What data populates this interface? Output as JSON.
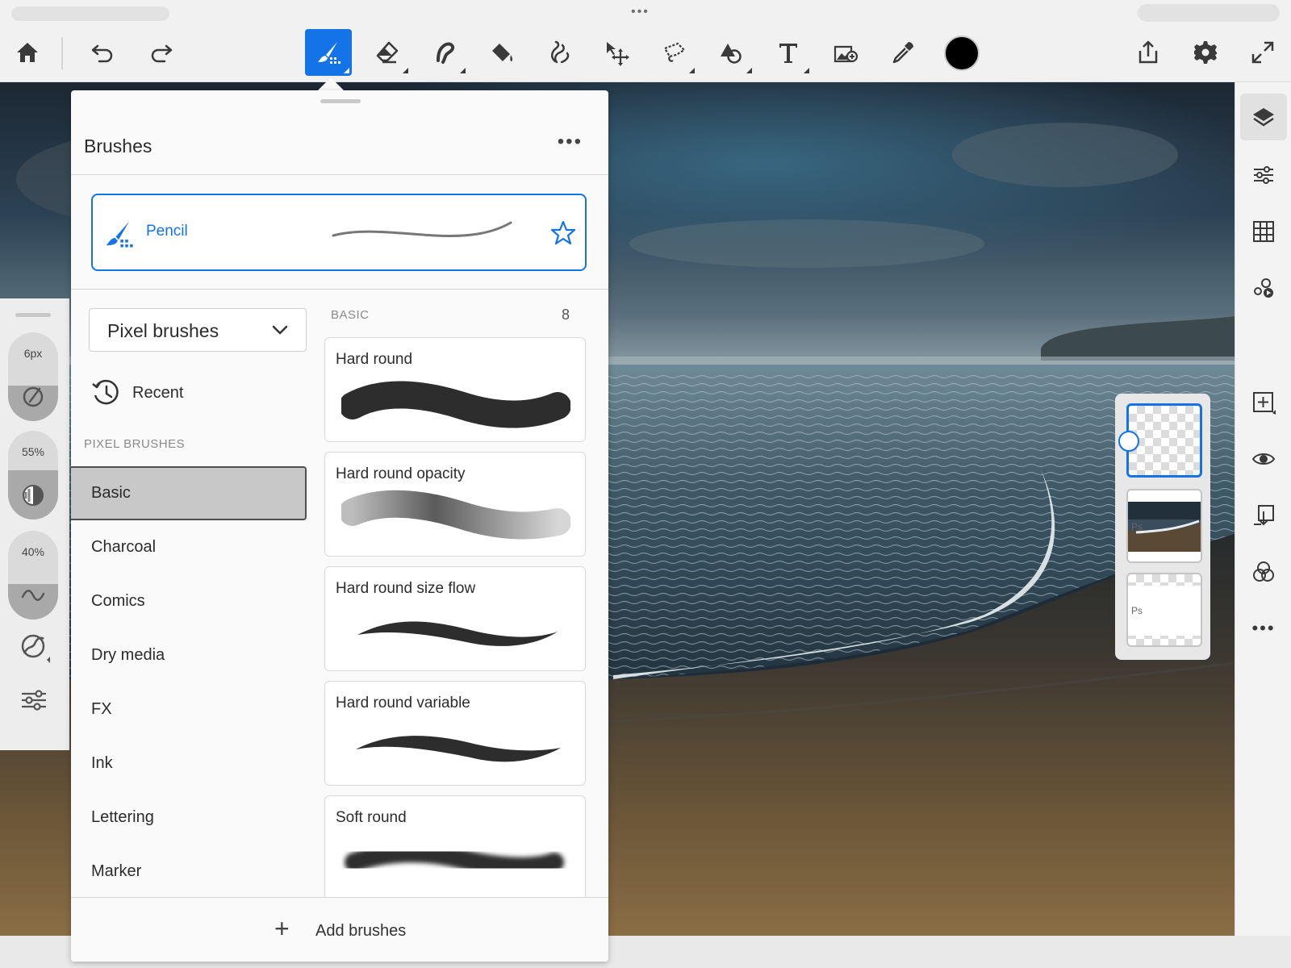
{
  "toolbar": {
    "tools": [
      "home",
      "undo",
      "redo",
      "brush",
      "eraser",
      "smudge",
      "fill",
      "liquify",
      "move",
      "lasso",
      "shape",
      "text",
      "add-image",
      "eyedropper",
      "color",
      "export",
      "settings",
      "fullscreen"
    ],
    "active_tool": "brush",
    "active_color": "#1473e6",
    "foreground_color": "#000000"
  },
  "panel": {
    "title": "Brushes",
    "more_label": "•••",
    "current_brush": "Pencil",
    "brush_set": "Pixel brushes",
    "recent_label": "Recent",
    "section_label": "PIXEL BRUSHES",
    "categories": [
      "Basic",
      "Charcoal",
      "Comics",
      "Dry media",
      "FX",
      "Ink",
      "Lettering",
      "Marker"
    ],
    "selected_category": "Basic",
    "basic_label": "BASIC",
    "basic_count": "8",
    "brushes": [
      {
        "name": "Hard round"
      },
      {
        "name": "Hard round opacity"
      },
      {
        "name": "Hard round size flow"
      },
      {
        "name": "Hard round variable"
      },
      {
        "name": "Soft round"
      }
    ],
    "add_label": "Add brushes"
  },
  "left_rail": {
    "size_label": "6px",
    "opacity_label": "55%",
    "flow_label": "40%",
    "opacity_value": 0.55,
    "flow_value": 0.4
  },
  "layers": {
    "tag": "Ps"
  },
  "status_dots": "•••",
  "right_rail_more": "•••"
}
